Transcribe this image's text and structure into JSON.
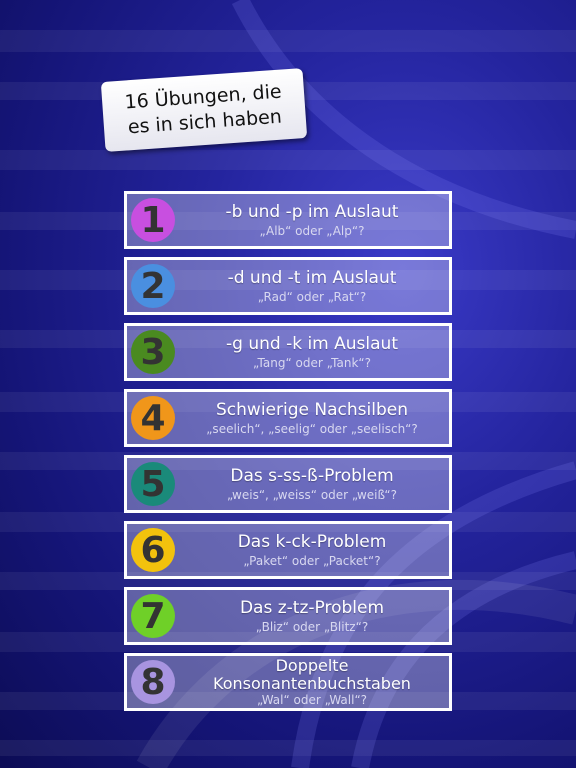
{
  "title": "16 Übungen, die\nes in sich haben",
  "items": [
    {
      "number": "1",
      "title": "-b und -p im Auslaut",
      "subtitle": "„Alb“ oder „Alp“?",
      "color": "#c84fe0"
    },
    {
      "number": "2",
      "title": "-d und -t im Auslaut",
      "subtitle": "„Rad“ oder „Rat“?",
      "color": "#4a8fe0"
    },
    {
      "number": "3",
      "title": "-g und -k im Auslaut",
      "subtitle": "„Tang“ oder „Tank“?",
      "color": "#4a8a20"
    },
    {
      "number": "4",
      "title": "Schwierige Nachsilben",
      "subtitle": "„seelich“, „seelig“ oder „seelisch“?",
      "color": "#f0961a"
    },
    {
      "number": "5",
      "title": "Das s-ss-ß-Problem",
      "subtitle": "„weis“, „weiss“ oder „weiß“?",
      "color": "#1a8a7a"
    },
    {
      "number": "6",
      "title": "Das k-ck-Problem",
      "subtitle": "„Paket“ oder „Packet“?",
      "color": "#f2c20d"
    },
    {
      "number": "7",
      "title": "Das z-tz-Problem",
      "subtitle": "„Bliz“ oder „Blitz“?",
      "color": "#6fd028"
    },
    {
      "number": "8",
      "title": "Doppelte Konsonantenbuchstaben",
      "subtitle": "„Wal“ oder „Wall“?",
      "color": "#a894e0"
    }
  ]
}
